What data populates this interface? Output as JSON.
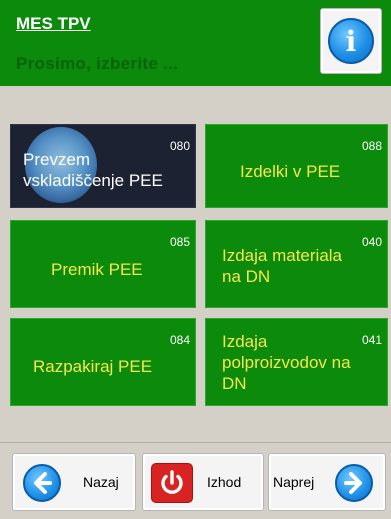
{
  "header": {
    "title": "MES TPV",
    "subtitle": "Prosimo, izberite ...",
    "info_icon": "info-icon",
    "header_color": "#0b8a0b"
  },
  "tiles": [
    {
      "label": "Prevzem v skladiščenje PEE",
      "line1": "Prevzem",
      "line2": "vskladiščenje PEE",
      "code": "080",
      "style": "dark"
    },
    {
      "label": "Izdelki v PEE",
      "code": "088"
    },
    {
      "label": "Premik PEE",
      "code": "085"
    },
    {
      "label": "Izdaja materiala na DN",
      "line1": "Izdaja materiala",
      "line2": "na DN",
      "code": "040"
    },
    {
      "label": "Razpakiraj PEE",
      "code": "084"
    },
    {
      "label": "Izdaja polproizvodov na DN",
      "line1": "Izdaja",
      "line2": "polproizvodov na",
      "line3": "DN",
      "code": "041"
    }
  ],
  "bottom": {
    "back_label": "Nazaj",
    "exit_label": "Izhod",
    "next_label": "Naprej",
    "back_icon": "arrow-left-icon",
    "exit_icon": "power-icon",
    "next_icon": "arrow-right-icon"
  },
  "colors": {
    "tile_green": "#0b8a0b",
    "tile_text": "#f5e84a",
    "tile_dark": "#1d2233"
  }
}
